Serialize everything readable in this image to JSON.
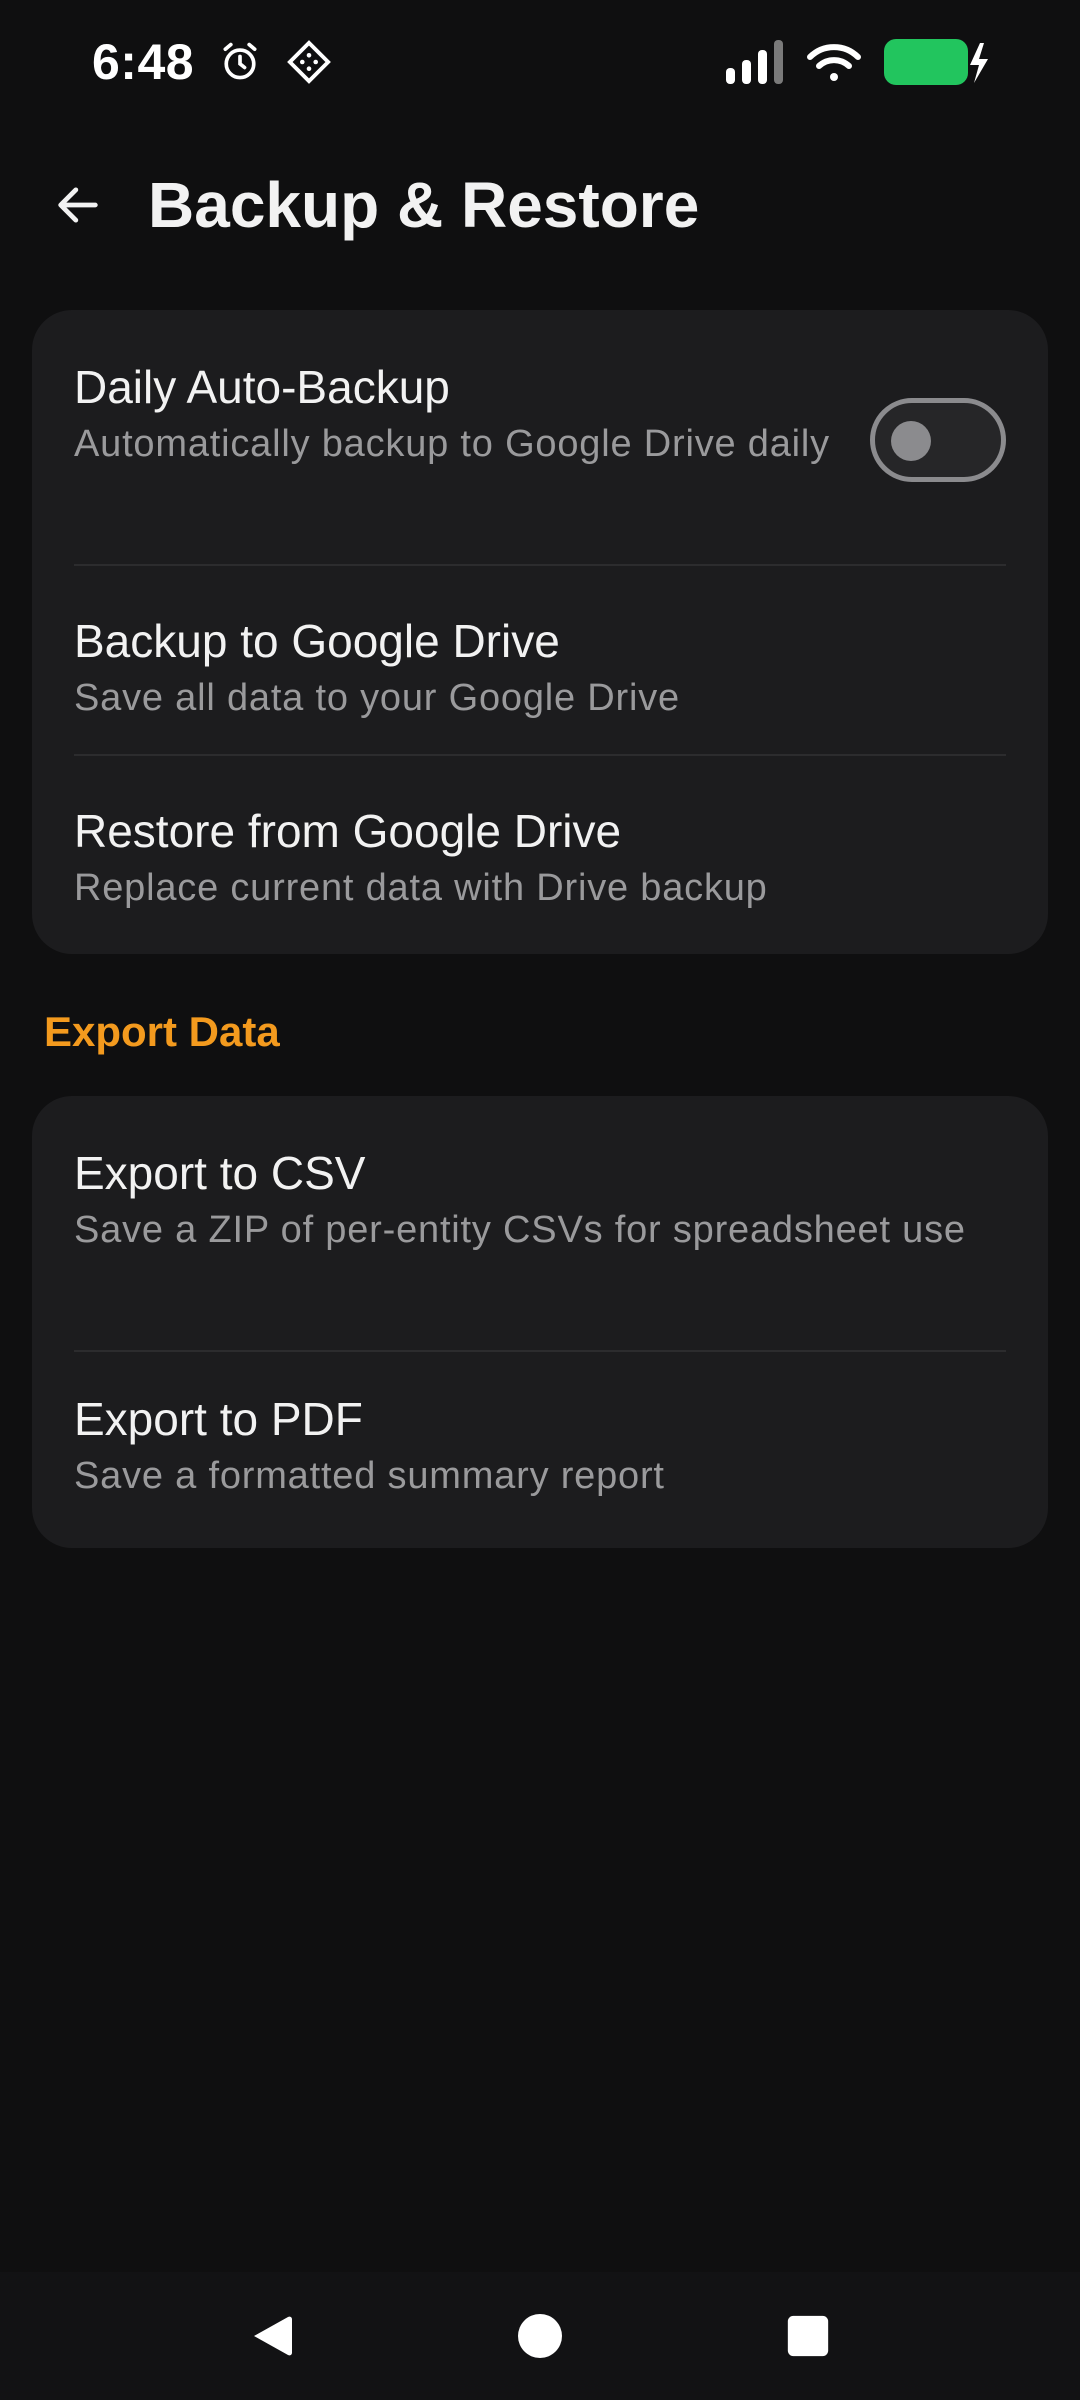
{
  "status_bar": {
    "time": "6:48",
    "icons": [
      "alarm-icon",
      "app-notification-icon",
      "signal-icon",
      "wifi-icon",
      "battery-charging-icon"
    ],
    "battery_color": "#22c55e"
  },
  "app_bar": {
    "title": "Backup & Restore",
    "back_icon": "arrow-left-icon"
  },
  "backup_section": {
    "items": [
      {
        "title": "Daily Auto-Backup",
        "subtitle": "Automatically backup to Google Drive daily",
        "toggle_on": false
      },
      {
        "title": "Backup to Google Drive",
        "subtitle": "Save all data to your Google Drive"
      },
      {
        "title": "Restore from Google Drive",
        "subtitle": "Replace current data with Drive backup"
      }
    ]
  },
  "export_section": {
    "header": "Export Data",
    "header_color": "#f39a1e",
    "items": [
      {
        "title": "Export to CSV",
        "subtitle": "Save a ZIP of per-entity CSVs for spreadsheet use"
      },
      {
        "title": "Export to PDF",
        "subtitle": "Save a formatted summary report"
      }
    ]
  },
  "nav_bar": {
    "buttons": [
      "nav-back-icon",
      "nav-home-icon",
      "nav-recents-icon"
    ]
  }
}
